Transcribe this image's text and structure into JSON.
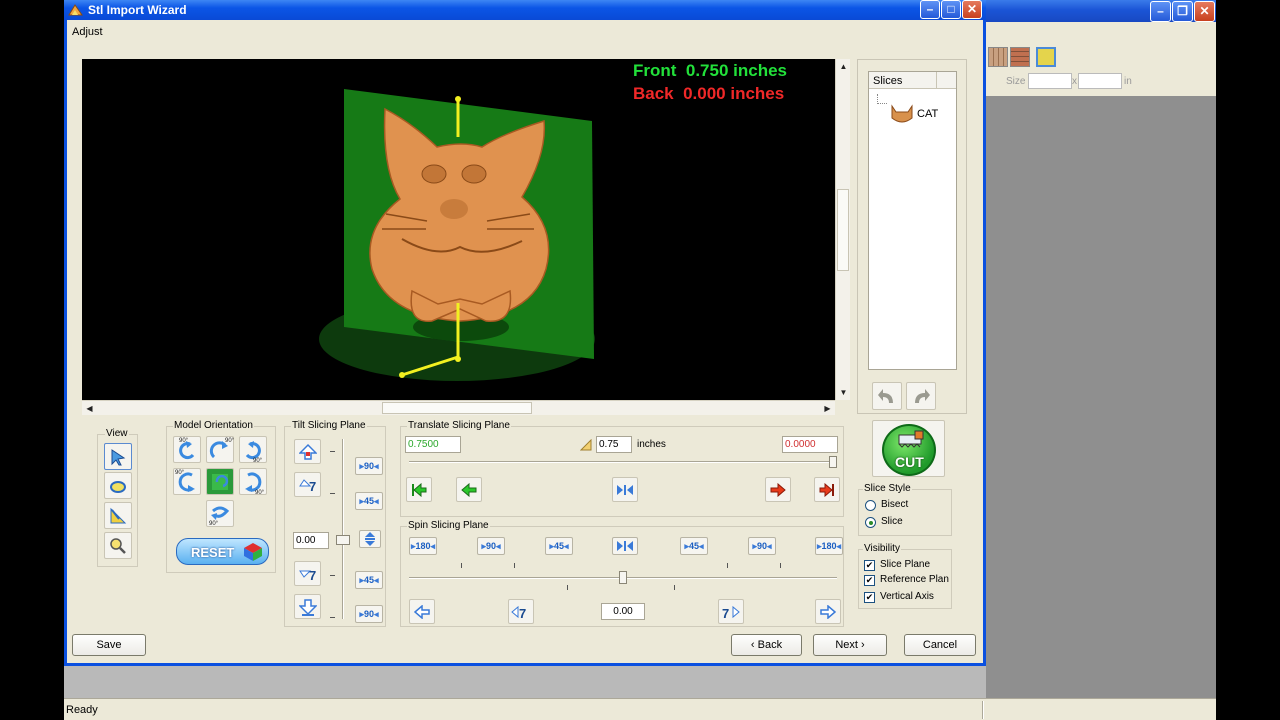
{
  "window": {
    "title": "Stl Import Wizard"
  },
  "menu": {
    "adjust": "Adjust"
  },
  "viewport": {
    "front_label": "Front  0.750 inches",
    "back_label": "Back  0.000 inches",
    "front_color": "#22e03a",
    "back_color": "#f02828"
  },
  "slices": {
    "header": "Slices",
    "items": [
      {
        "label": "CAT"
      }
    ]
  },
  "groups": {
    "view": "View",
    "model_orientation": "Model Orientation",
    "tilt": "Tilt Slicing Plane",
    "translate": "Translate Slicing Plane",
    "spin": "Spin Slicing Plane",
    "slice_style": "Slice Style",
    "visibility": "Visibility"
  },
  "model_orientation": {
    "reset_label": "RESET",
    "badge": "90°"
  },
  "tilt": {
    "value": "0.00",
    "labels": {
      "p90": "90",
      "p45": "45",
      "n45": "45",
      "n90": "90"
    }
  },
  "translate": {
    "front_value": "0.7500",
    "back_value": "0.0000",
    "step_value": "0.75",
    "unit": "inches",
    "slider_fraction": 1.0
  },
  "spin": {
    "value": "0.00",
    "labels": [
      "180",
      "90",
      "45",
      "45",
      "90",
      "180"
    ],
    "slider_fraction": 0.5
  },
  "cut_button": {
    "label": "CUT"
  },
  "slice_style": {
    "options": [
      {
        "label": "Bisect",
        "selected": false
      },
      {
        "label": "Slice",
        "selected": true
      }
    ]
  },
  "visibility": {
    "items": [
      {
        "label": "Slice Plane",
        "checked": true
      },
      {
        "label": "Reference Plan",
        "checked": true
      },
      {
        "label": "Vertical Axis",
        "checked": true
      }
    ]
  },
  "footer": {
    "save": "Save",
    "back": "‹ Back",
    "next": "Next ›",
    "cancel": "Cancel"
  },
  "statusbar": {
    "text": "Ready"
  },
  "bg_toolbar": {
    "size_label": "Size",
    "x_label": "x",
    "unit": "in"
  }
}
